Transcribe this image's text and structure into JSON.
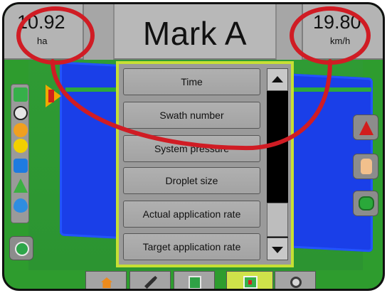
{
  "status_bar": {
    "area_value": "10.92",
    "area_unit": "ha",
    "title": "Mark A",
    "speed_value": "19.80",
    "speed_unit": "km/h"
  },
  "menu": {
    "items": [
      {
        "label": "Time"
      },
      {
        "label": "Swath number"
      },
      {
        "label": "System pressure"
      },
      {
        "label": "Droplet size"
      },
      {
        "label": "Actual application rate"
      },
      {
        "label": "Target application rate"
      }
    ]
  },
  "bottom_tabs": [
    {
      "name": "home",
      "icon": "home-icon"
    },
    {
      "name": "tools",
      "icon": "tools-icon"
    },
    {
      "name": "guidance",
      "icon": "guidance-icon"
    },
    {
      "name": "mark",
      "icon": "mark-icon",
      "selected": true
    },
    {
      "name": "camera",
      "icon": "camera-icon"
    }
  ],
  "colors": {
    "field": "#2e9c2e",
    "coverage": "#1a3fe8",
    "menu_highlight": "#c7df34",
    "annotation": "#d01c24"
  }
}
